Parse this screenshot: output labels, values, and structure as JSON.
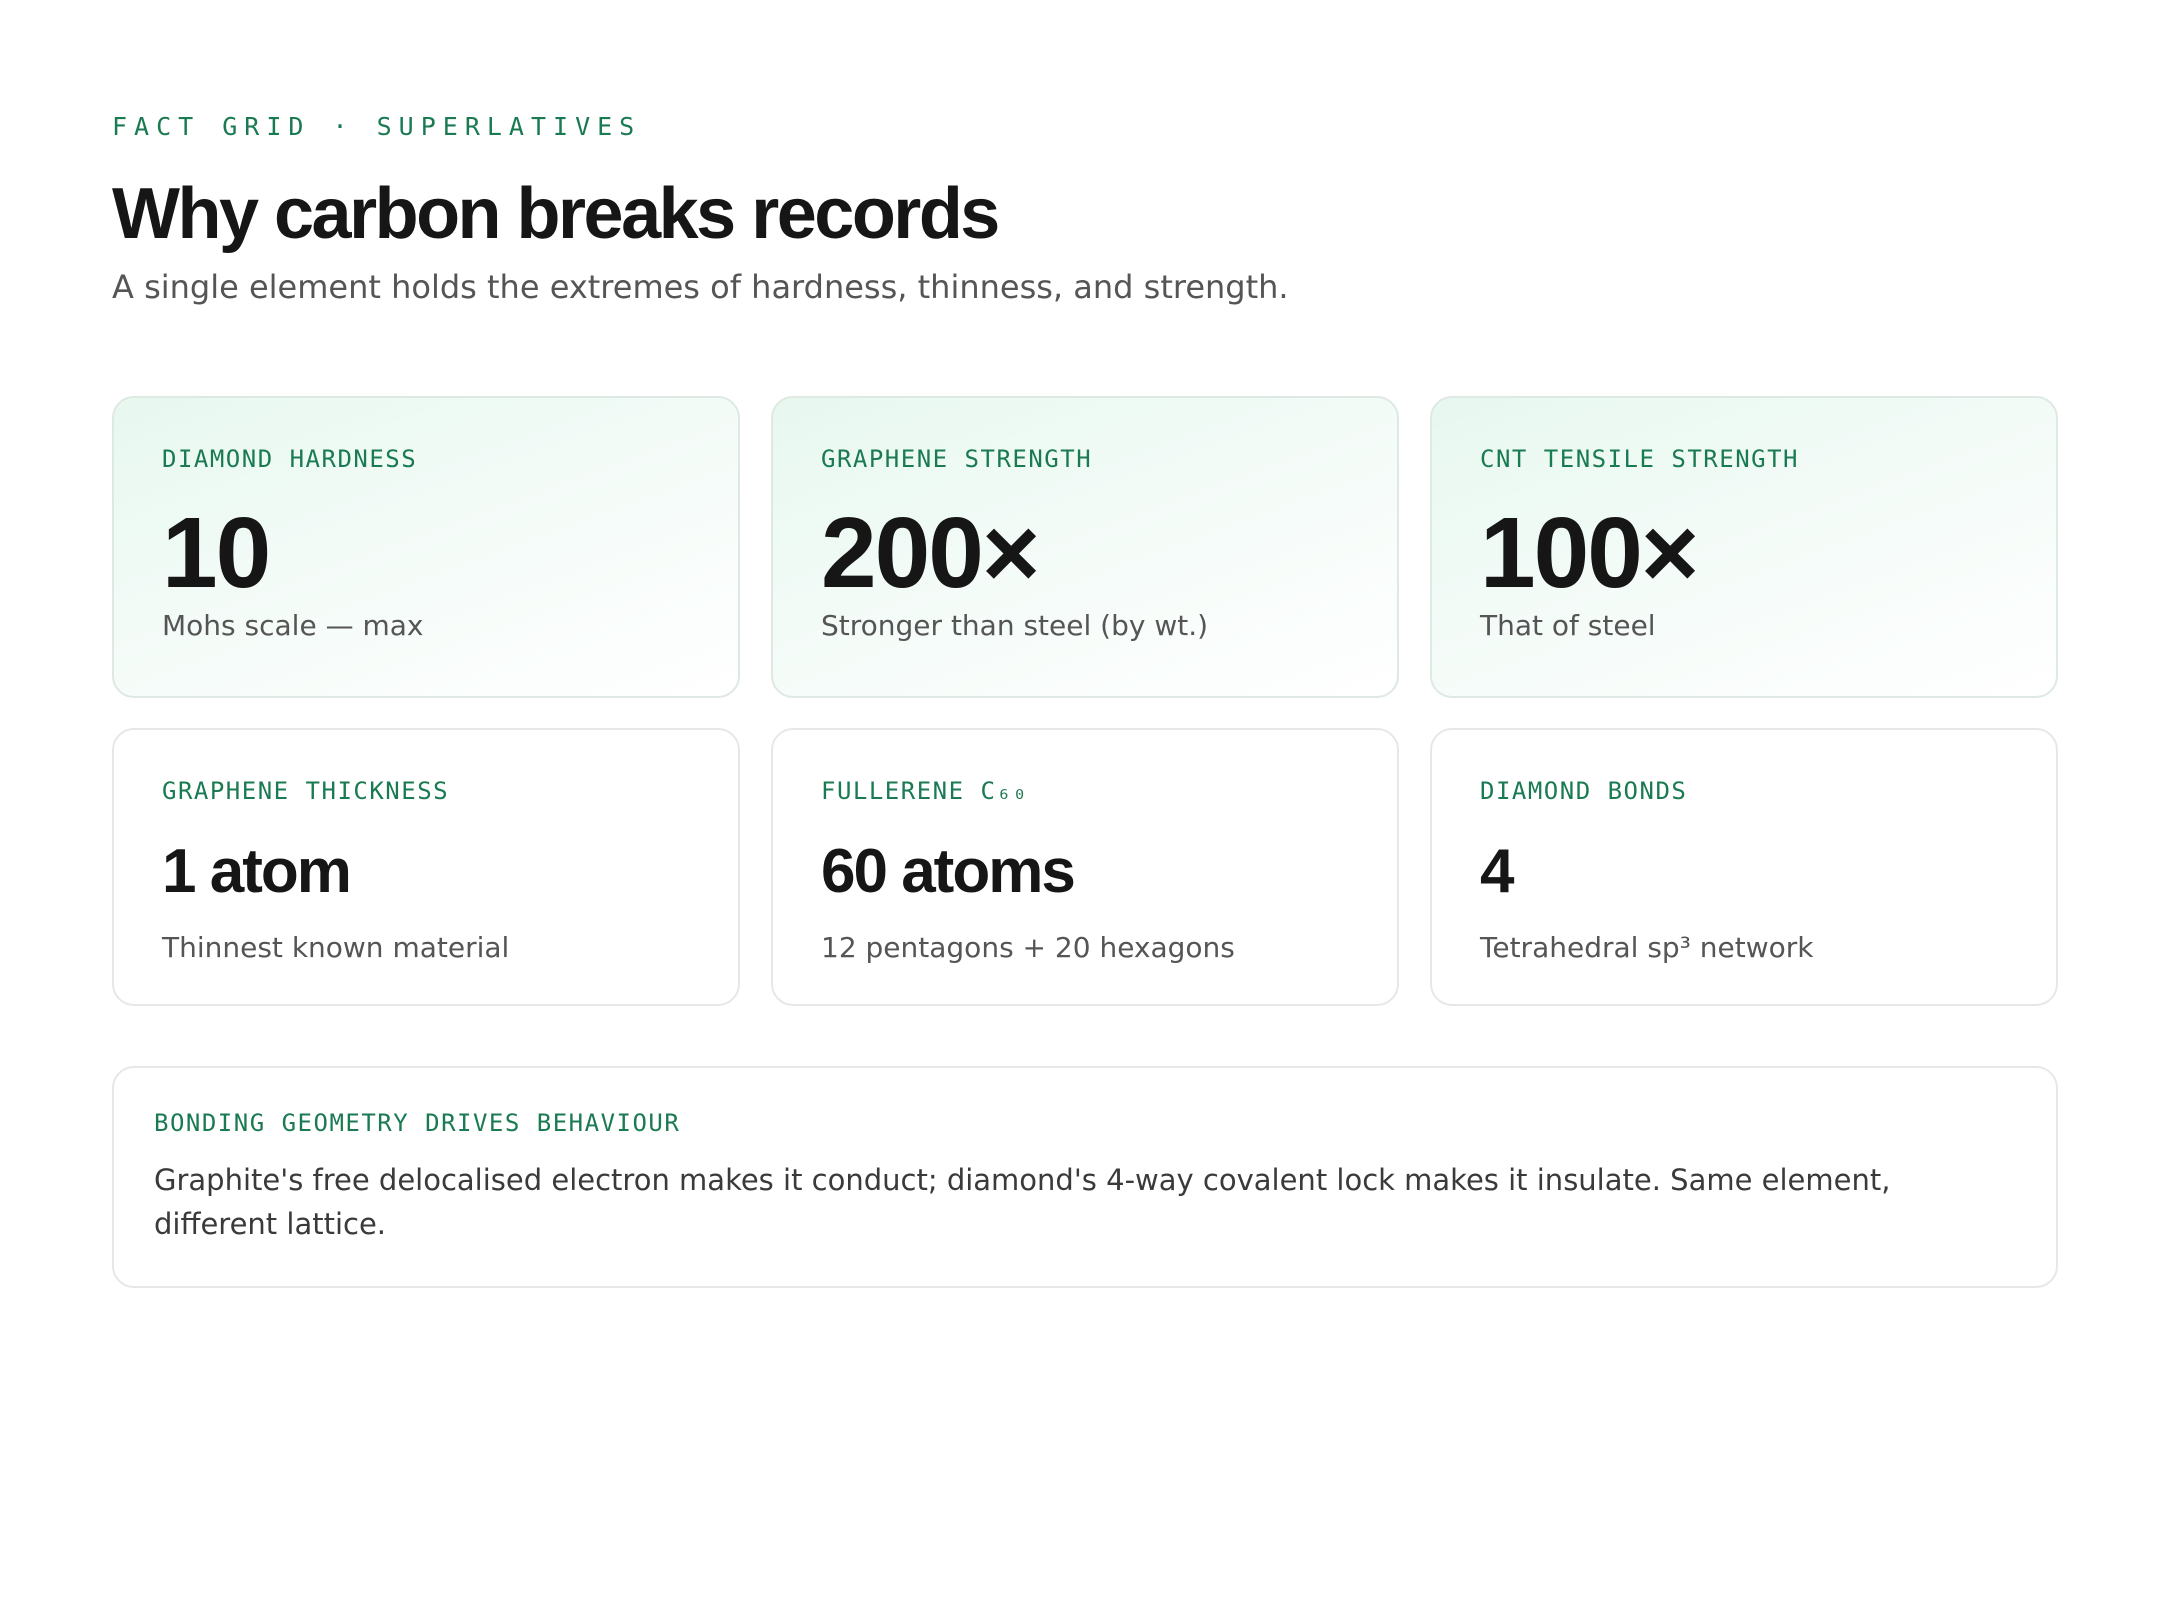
{
  "header": {
    "eyebrow": "FACT GRID · SUPERLATIVES",
    "title": "Why carbon breaks records",
    "subtitle": "A single element holds the extremes of hardness, thinness, and strength."
  },
  "facts": [
    {
      "label": "DIAMOND HARDNESS",
      "value": "10",
      "caption": "Mohs scale — max"
    },
    {
      "label": "GRAPHENE STRENGTH",
      "value": "200×",
      "caption": "Stronger than steel (by wt.)"
    },
    {
      "label": "CNT TENSILE STRENGTH",
      "value": "100×",
      "caption": "That of steel"
    },
    {
      "label": "GRAPHENE THICKNESS",
      "value": "1 atom",
      "caption": "Thinnest known material"
    },
    {
      "label": "FULLERENE C₆₀",
      "value": "60 atoms",
      "caption": "12 pentagons + 20 hexagons"
    },
    {
      "label": "DIAMOND BONDS",
      "value": "4",
      "caption": "Tetrahedral sp³ network"
    }
  ],
  "note": {
    "label": "BONDING GEOMETRY DRIVES BEHAVIOUR",
    "text": "Graphite's free delocalised electron makes it conduct; diamond's 4-way covalent lock makes it insulate. Same element, different lattice."
  },
  "colors": {
    "accent": "#1a7a52",
    "featured_tint": "#e7f8ef",
    "border": "#e6e8e7"
  }
}
